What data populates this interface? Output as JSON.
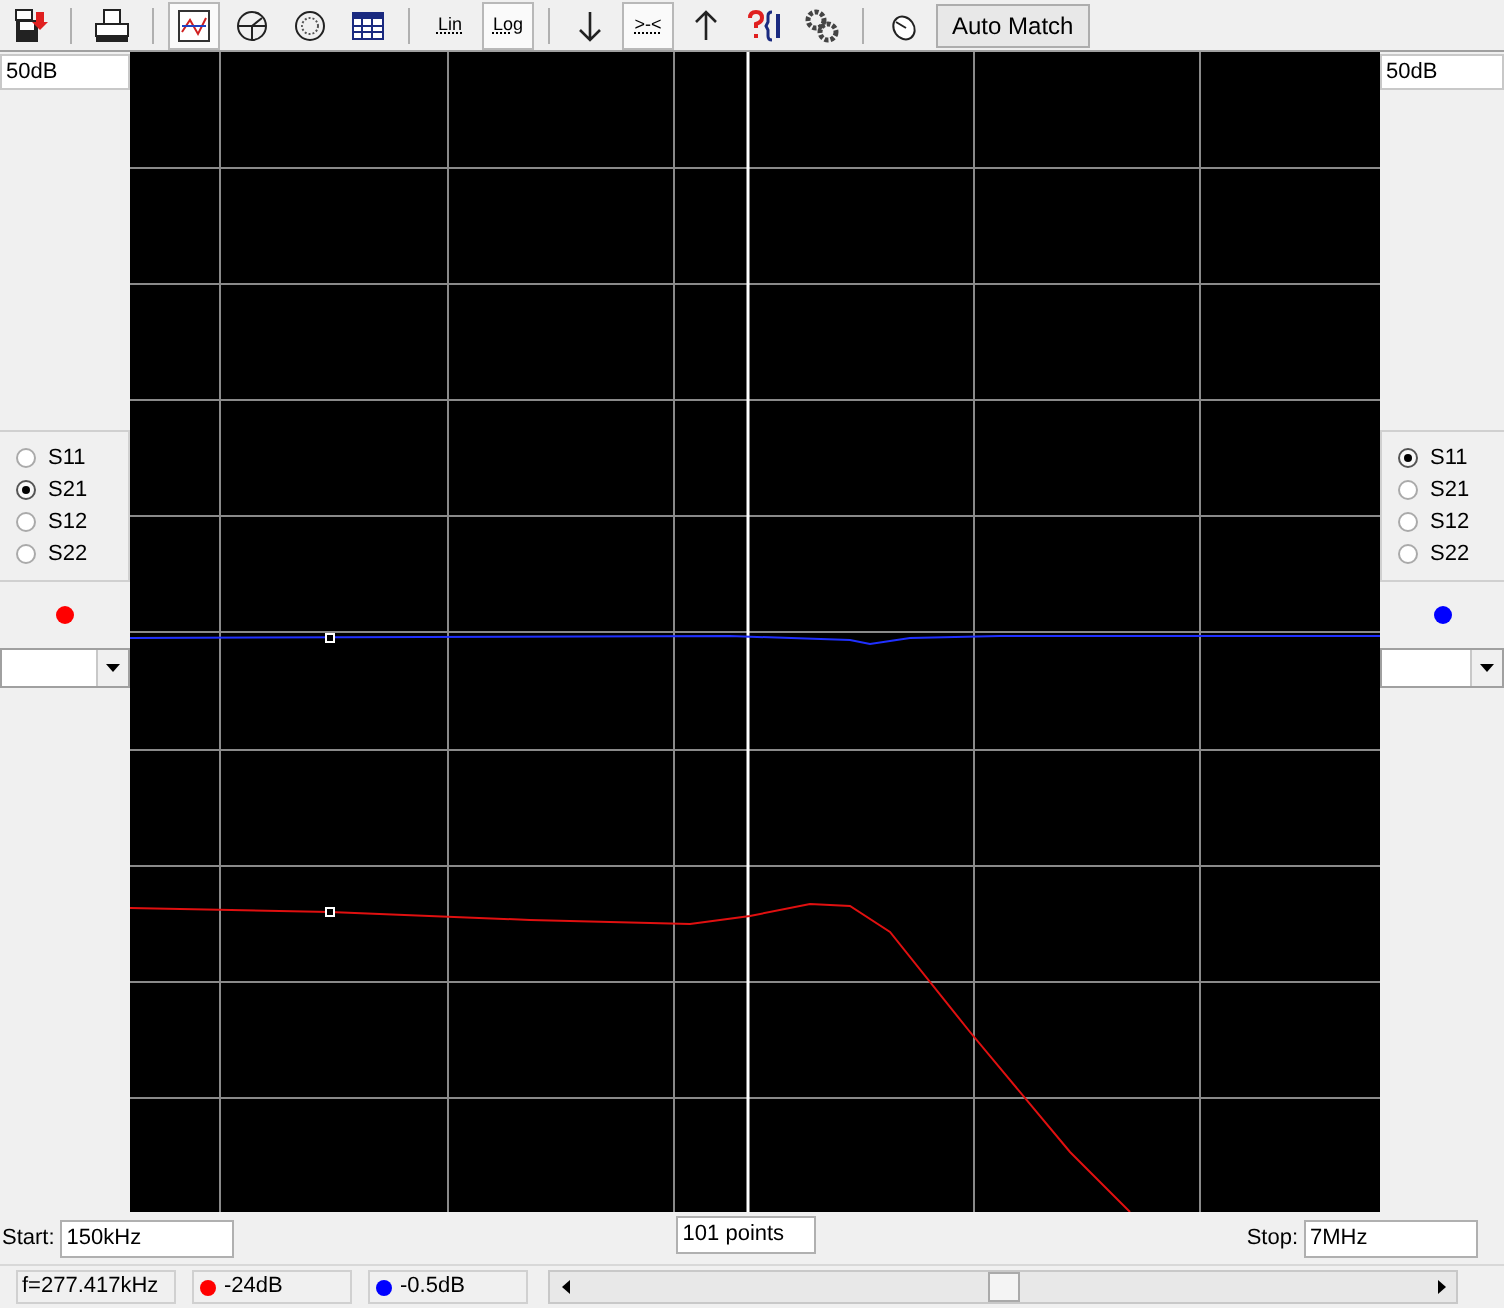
{
  "toolbar": [
    {
      "kind": "icon",
      "pressed": false
    },
    {
      "kind": "separator"
    },
    {
      "kind": "icon",
      "pressed": false
    },
    {
      "kind": "separator"
    },
    {
      "kind": "icon",
      "pressed": true
    },
    {
      "kind": "icon",
      "pressed": false
    },
    {
      "kind": "icon",
      "pressed": false
    },
    {
      "kind": "icon",
      "pressed": false
    },
    {
      "kind": "separator"
    },
    {
      "kind": "text",
      "label": "Lin",
      "pressed": false
    },
    {
      "kind": "text",
      "label": "Log",
      "pressed": true
    },
    {
      "kind": "separator"
    },
    {
      "kind": "icon",
      "pressed": false
    },
    {
      "kind": "text",
      "label": ">-<",
      "pressed": true
    },
    {
      "kind": "icon",
      "pressed": false
    },
    {
      "kind": "icon",
      "pressed": false
    },
    {
      "kind": "icon",
      "pressed": false
    },
    {
      "kind": "separator"
    },
    {
      "kind": "icon",
      "pressed": false
    },
    {
      "kind": "button",
      "label": "Auto Match"
    }
  ],
  "left_panel": {
    "scale": "50dB",
    "params": [
      {
        "label": "S11",
        "selected": false
      },
      {
        "label": "S21",
        "selected": true
      },
      {
        "label": "S12",
        "selected": false
      },
      {
        "label": "S22",
        "selected": false
      }
    ],
    "color": "#ff0000"
  },
  "right_panel": {
    "scale": "50dB",
    "params": [
      {
        "label": "S11",
        "selected": true
      },
      {
        "label": "S21",
        "selected": false
      },
      {
        "label": "S12",
        "selected": false
      },
      {
        "label": "S22",
        "selected": false
      }
    ],
    "color": "#0000ff"
  },
  "sweep": {
    "start_label": "Start:",
    "start_value": "150kHz",
    "points": "101 points",
    "stop_label": "Stop:",
    "stop_value": "7MHz"
  },
  "status_bar": {
    "frequency": "f=277.417kHz",
    "readouts": [
      {
        "color": "#ff0000",
        "value": "-24dB"
      },
      {
        "color": "#0000ff",
        "value": "-0.5dB"
      }
    ]
  }
}
